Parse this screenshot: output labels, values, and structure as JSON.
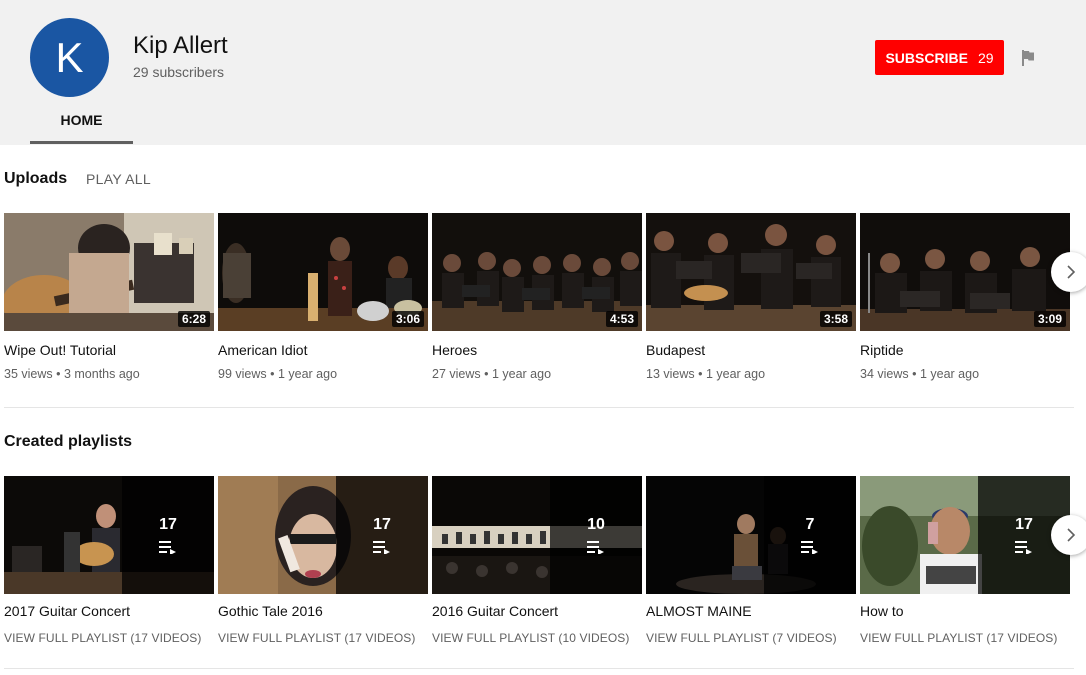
{
  "channel": {
    "avatar_letter": "K",
    "name": "Kip Allert",
    "subscribers": "29 subscribers",
    "subscribe_label": "SUBSCRIBE",
    "subscribe_count": "29",
    "tab_home": "HOME"
  },
  "uploads": {
    "title": "Uploads",
    "play_all": "PLAY ALL",
    "videos": [
      {
        "title": "Wipe Out! Tutorial",
        "meta": "35 views • 3 months ago",
        "duration": "6:28"
      },
      {
        "title": "American Idiot",
        "meta": "99 views • 1 year ago",
        "duration": "3:06"
      },
      {
        "title": "Heroes",
        "meta": "27 views • 1 year ago",
        "duration": "4:53"
      },
      {
        "title": "Budapest",
        "meta": "13 views • 1 year ago",
        "duration": "3:58"
      },
      {
        "title": "Riptide",
        "meta": "34 views • 1 year ago",
        "duration": "3:09"
      }
    ]
  },
  "playlists": {
    "title": "Created playlists",
    "items": [
      {
        "title": "2017 Guitar Concert",
        "link": "VIEW FULL PLAYLIST (17 VIDEOS)",
        "count": "17"
      },
      {
        "title": "Gothic Tale 2016",
        "link": "VIEW FULL PLAYLIST (17 VIDEOS)",
        "count": "17"
      },
      {
        "title": "2016 Guitar Concert",
        "link": "VIEW FULL PLAYLIST (10 VIDEOS)",
        "count": "10"
      },
      {
        "title": "ALMOST MAINE",
        "link": "VIEW FULL PLAYLIST (7 VIDEOS)",
        "count": "7"
      },
      {
        "title": "How to",
        "link": "VIEW FULL PLAYLIST (17 VIDEOS)",
        "count": "17"
      }
    ]
  },
  "colors": {
    "subscribe": "#ff0000",
    "avatar": "#1a56a3",
    "header_bg": "#f1f1f1"
  },
  "icons": [
    "flag-icon",
    "chevron-right-icon",
    "playlist-icon"
  ]
}
